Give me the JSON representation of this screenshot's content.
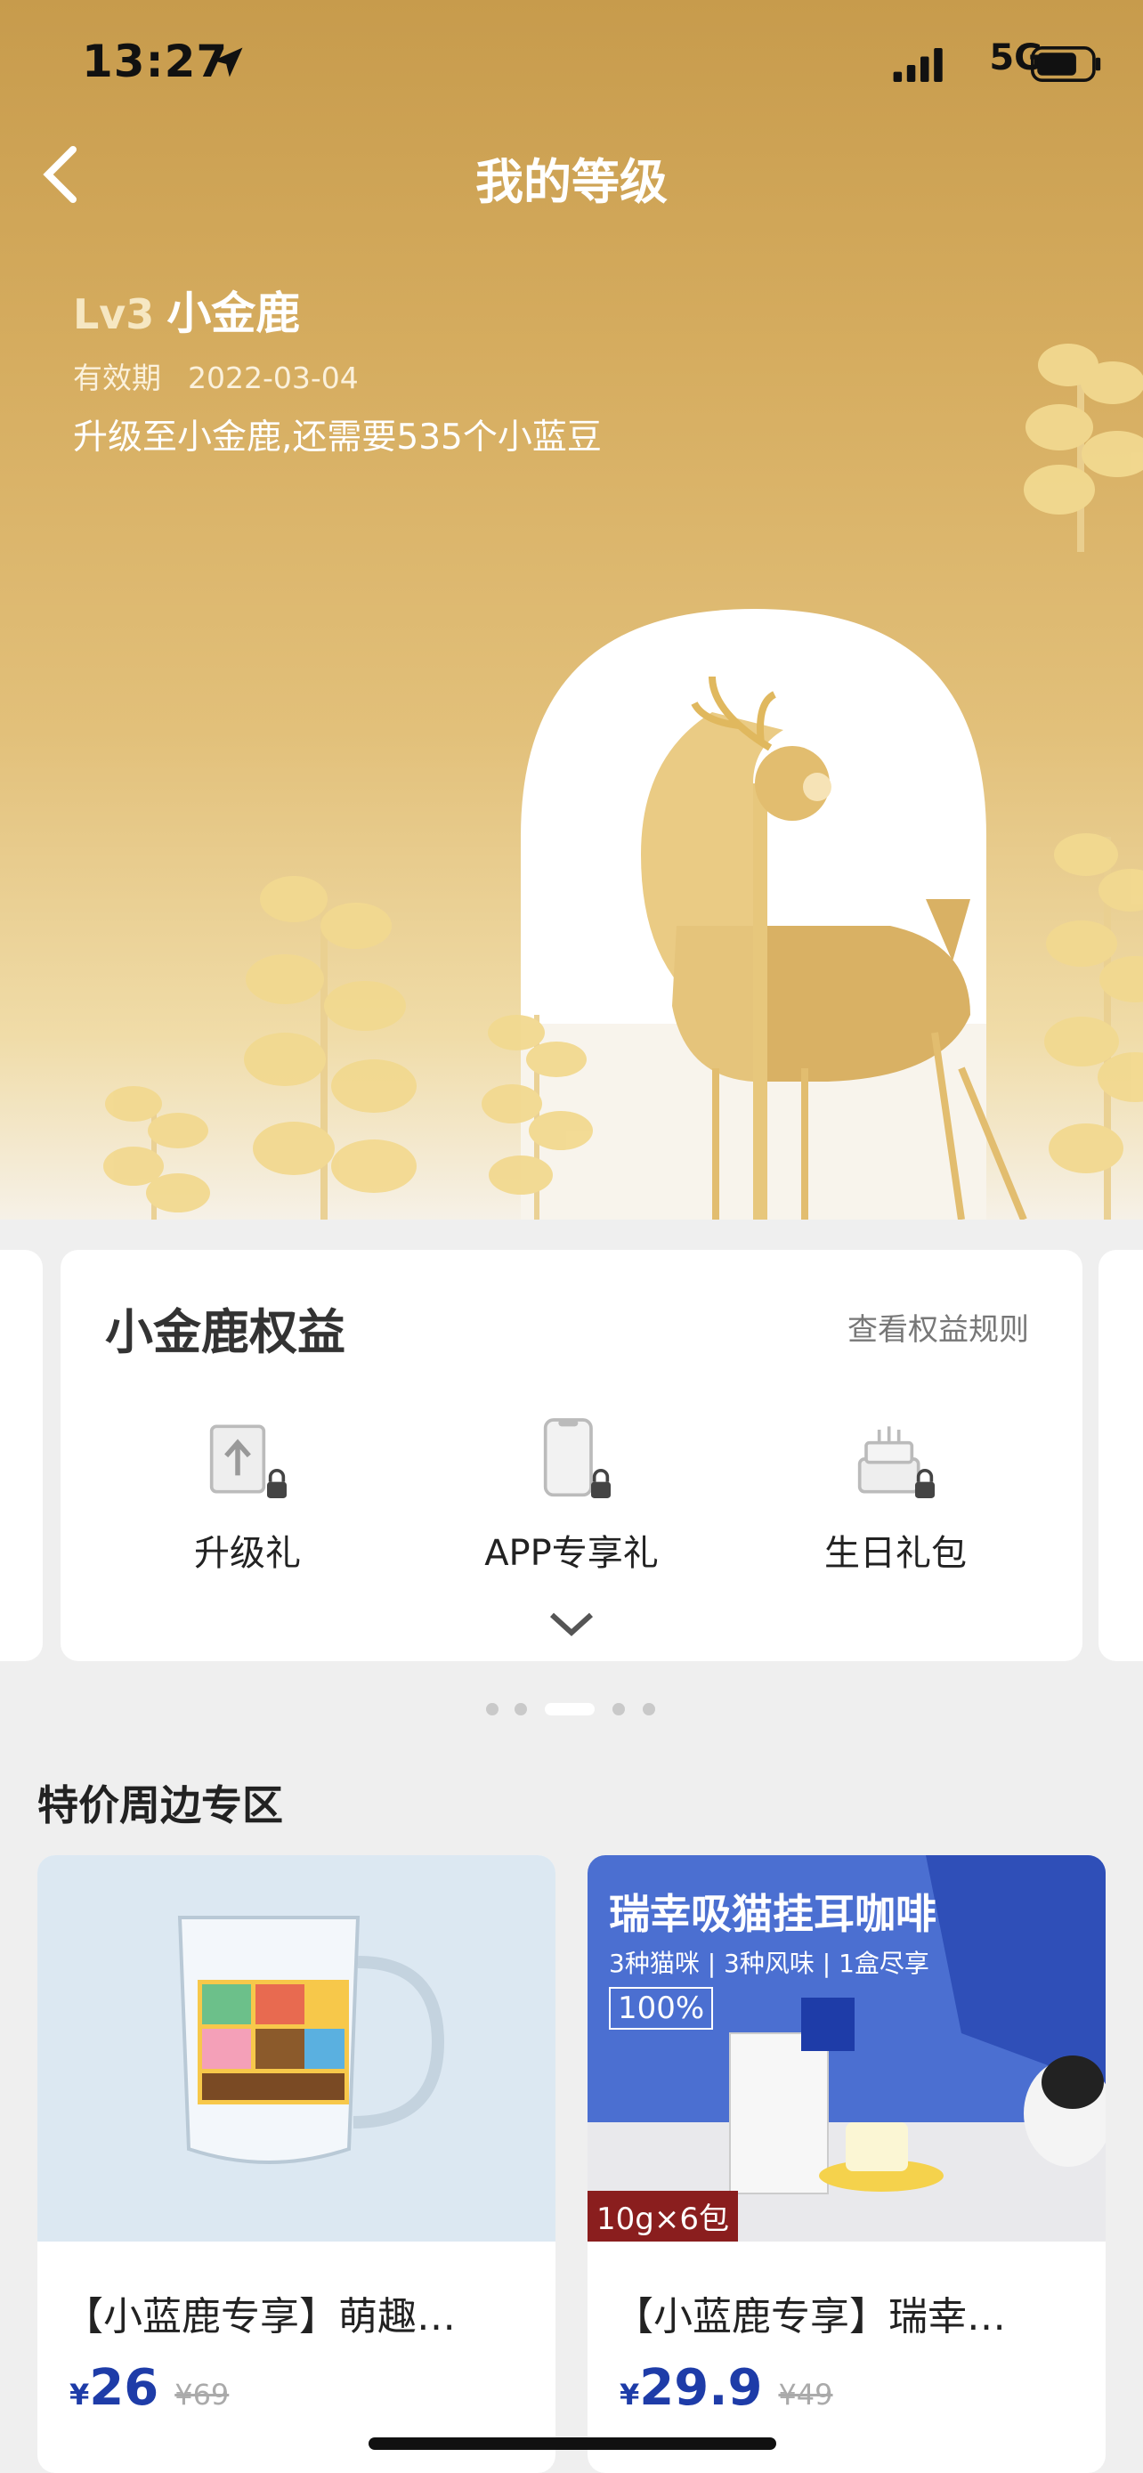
{
  "status_bar": {
    "time": "13:27",
    "network": "5G"
  },
  "header": {
    "title": "我的等级"
  },
  "level": {
    "badge": "Lv3",
    "name": "小金鹿",
    "validity_label": "有效期",
    "validity_date": "2022-03-04",
    "upgrade_text": "升级至小金鹿,还需要535个小蓝豆"
  },
  "benefits_card": {
    "title": "小金鹿权益",
    "rules_link": "查看权益规则",
    "items": [
      {
        "label": "升级礼",
        "icon": "upgrade-gift-icon",
        "locked": true
      },
      {
        "label": "APP专享礼",
        "icon": "phone-gift-icon",
        "locked": true
      },
      {
        "label": "生日礼包",
        "icon": "birthday-cake-icon",
        "locked": true
      }
    ]
  },
  "pager": {
    "count": 5,
    "active_index": 2
  },
  "section": {
    "title": "特价周边专区"
  },
  "products": [
    {
      "name": "【小蓝鹿专享】萌趣…",
      "currency": "¥",
      "price": "26",
      "original_price": "¥69"
    },
    {
      "name": "【小蓝鹿专享】瑞幸…",
      "currency": "¥",
      "price": "29.9",
      "original_price": "¥49",
      "ad": {
        "title": "瑞幸吸猫挂耳咖啡",
        "subtitle": "3种猫咪 | 3种风味 | 1盒尽享",
        "badge": "100%",
        "tag": "10g×6包"
      }
    }
  ],
  "colors": {
    "accent_gold": "#d6ad60",
    "price_blue": "#1e3ca8"
  }
}
